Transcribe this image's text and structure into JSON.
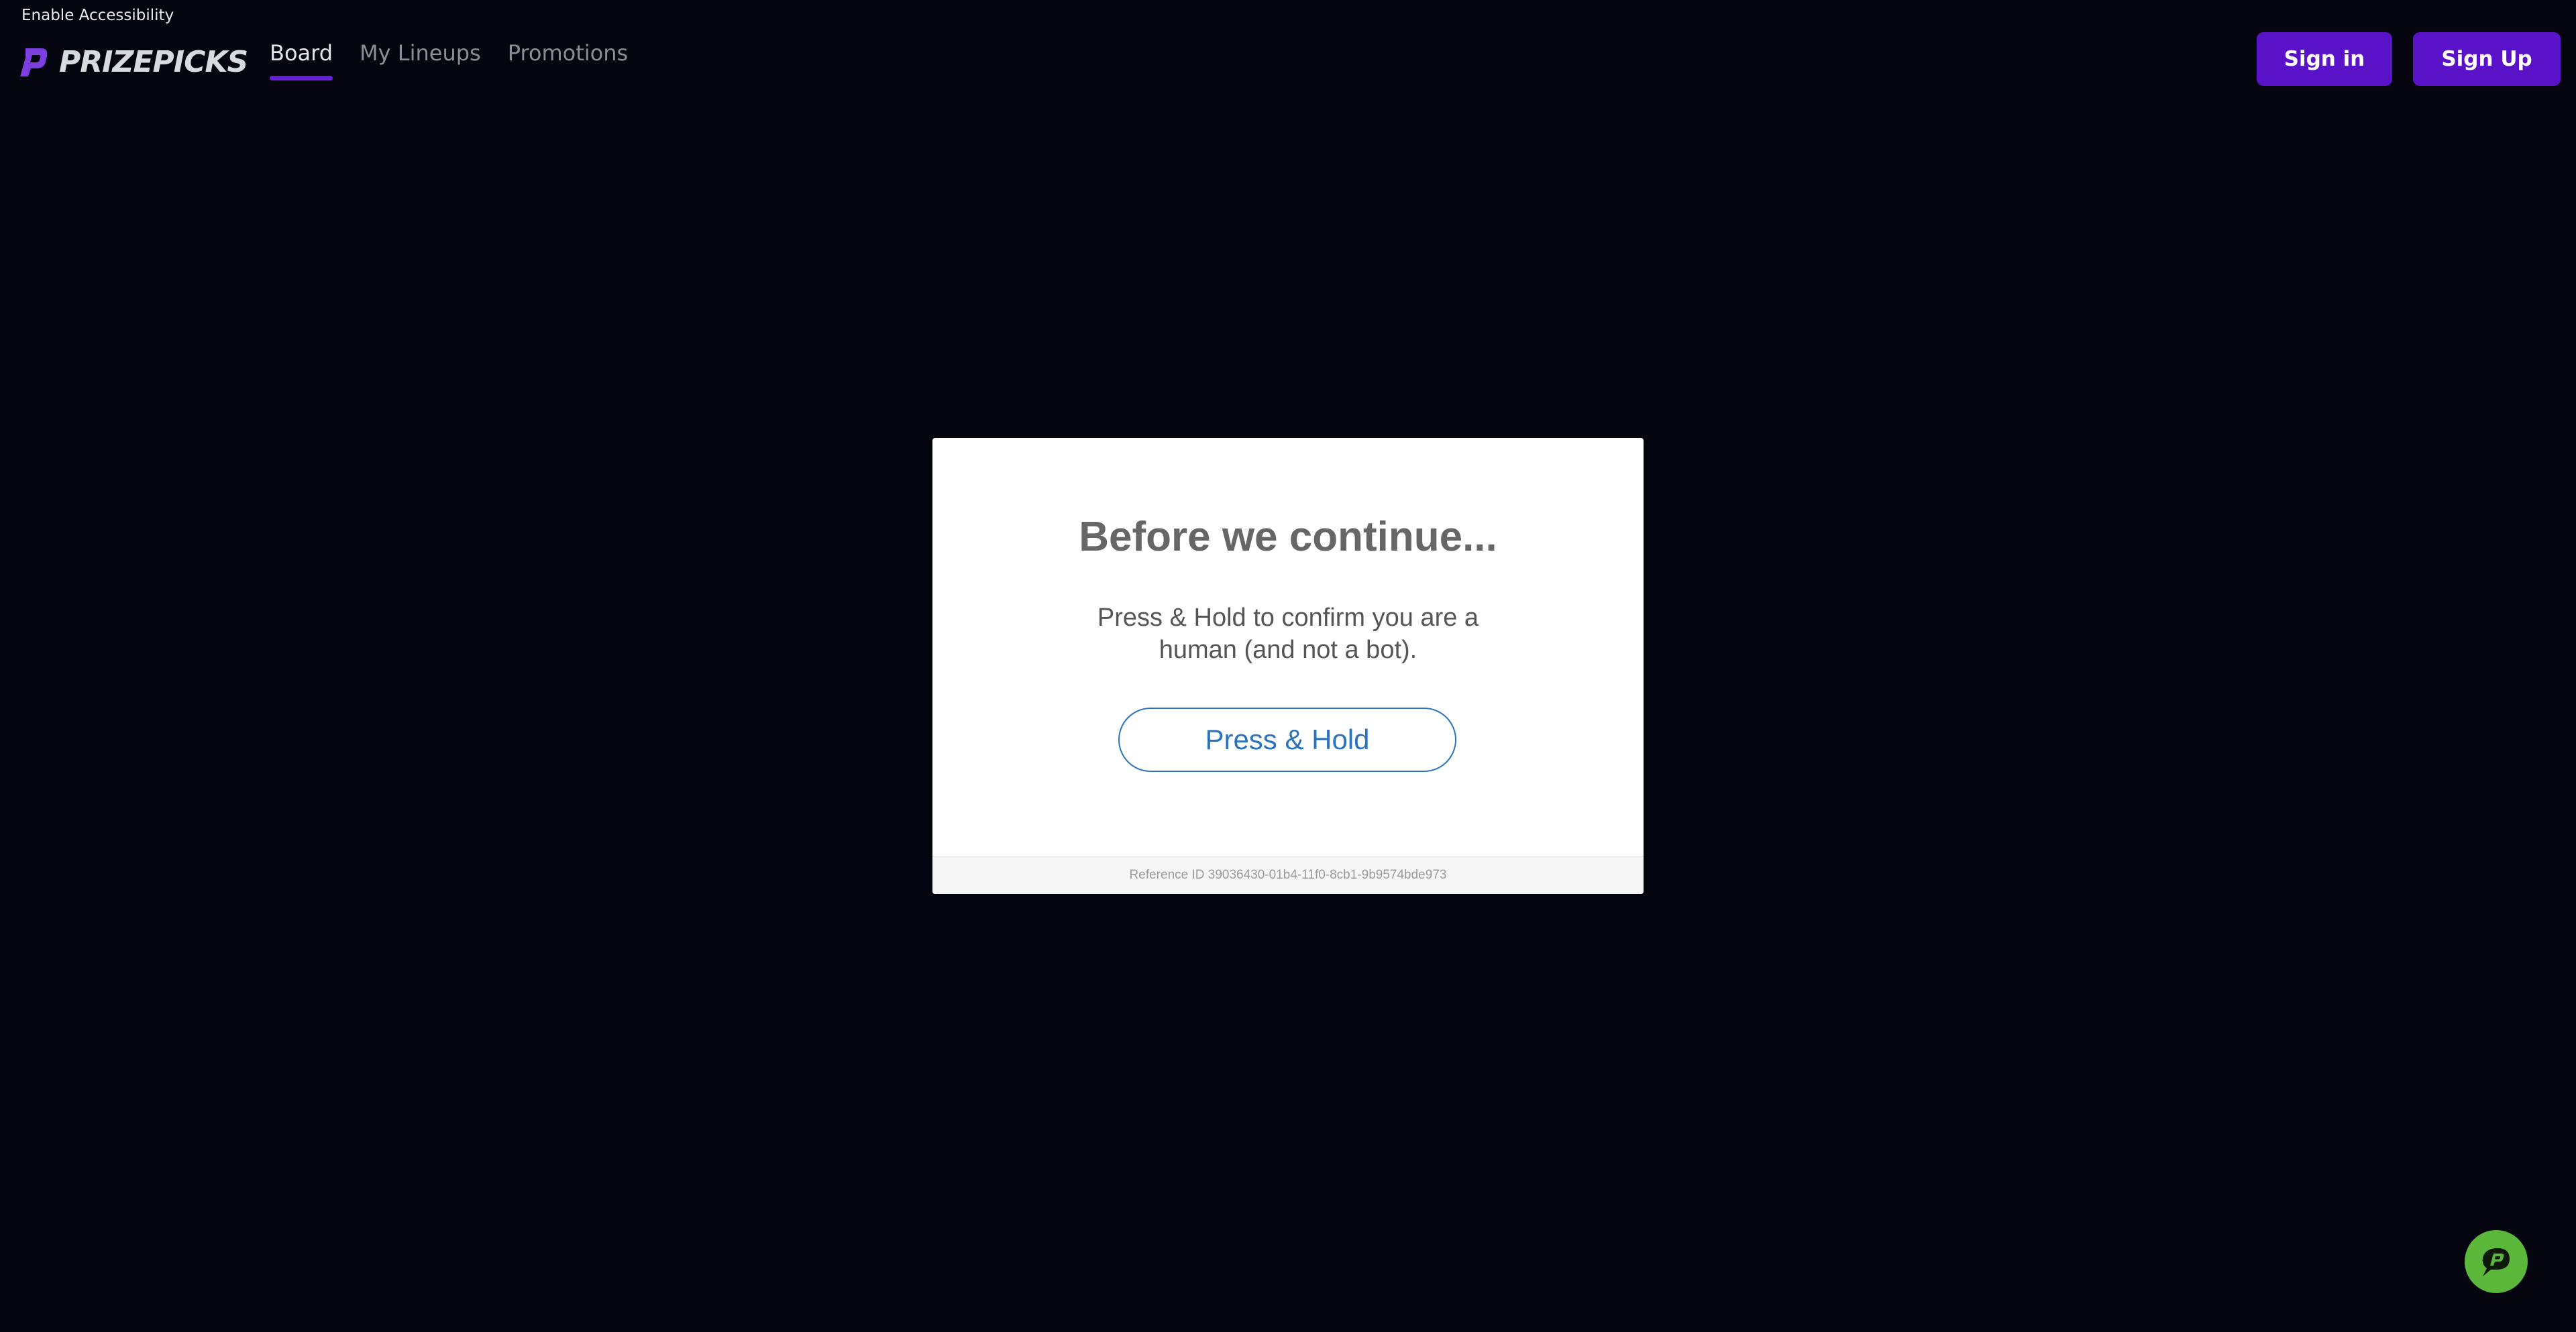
{
  "accessibility": {
    "label": "Enable Accessibility"
  },
  "header": {
    "logo_text": "PRIZEPICKS",
    "nav": [
      {
        "label": "Board",
        "active": true
      },
      {
        "label": "My Lineups",
        "active": false
      },
      {
        "label": "Promotions",
        "active": false
      }
    ],
    "sign_in_label": "Sign in",
    "sign_up_label": "Sign Up"
  },
  "modal": {
    "title": "Before we continue...",
    "description": "Press & Hold to confirm you are a human (and not a bot).",
    "button_label": "Press & Hold",
    "reference": "Reference ID 39036430-01b4-11f0-8cb1-9b9574bde973"
  },
  "chat": {
    "icon": "prizepicks-chat-icon"
  },
  "colors": {
    "background": "#05050f",
    "brand_purple": "#5a12c8",
    "nav_underline": "#6a1ed8",
    "press_hold_blue": "#2b73be",
    "chat_green": "#5cb83a"
  }
}
